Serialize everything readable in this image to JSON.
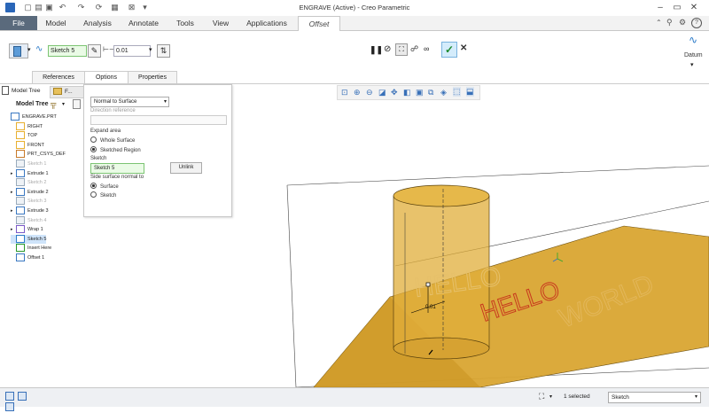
{
  "window": {
    "title": "ENGRAVE (Active) - Creo Parametric"
  },
  "menu": {
    "file": "File",
    "model": "Model",
    "analysis": "Analysis",
    "annotate": "Annotate",
    "tools": "Tools",
    "view": "View",
    "applications": "Applications",
    "offset": "Offset"
  },
  "ribbon": {
    "sketch_field": "Sketch 5",
    "offset_value": "0.01",
    "datum_label": "Datum"
  },
  "subtabs": {
    "references": "References",
    "options": "Options",
    "properties": "Properties"
  },
  "left_tabs": {
    "model_tree": "Model Tree",
    "folder": "F..."
  },
  "tree": {
    "header": "Model Tree",
    "items": [
      {
        "label": "ENGRAVE.PRT",
        "dim": false
      },
      {
        "label": "RIGHT",
        "dim": false
      },
      {
        "label": "TOP",
        "dim": false
      },
      {
        "label": "FRONT",
        "dim": false
      },
      {
        "label": "PRT_CSYS_DEF",
        "dim": false
      },
      {
        "label": "Sketch 1",
        "dim": true
      },
      {
        "label": "Extrude 1",
        "dim": false
      },
      {
        "label": "Sketch 2",
        "dim": true
      },
      {
        "label": "Extrude 2",
        "dim": false
      },
      {
        "label": "Sketch 3",
        "dim": true
      },
      {
        "label": "Extrude 3",
        "dim": false
      },
      {
        "label": "Sketch 4",
        "dim": true
      },
      {
        "label": "Wrap 1",
        "dim": false
      },
      {
        "label": "Sketch 5",
        "dim": false
      },
      {
        "label": "Insert Here",
        "dim": false
      },
      {
        "label": "Offset 1",
        "dim": false
      }
    ]
  },
  "options": {
    "dropdown": "Normal to Surface",
    "direction_reference": "Direction reference",
    "expand_area": "Expand area",
    "whole_surface": "Whole Surface",
    "sketched_region": "Sketched Region",
    "sketch_label": "Sketch",
    "sketch_value": "Sketch 5",
    "unlink": "Unlink",
    "side_normal": "Side surface normal to",
    "surface": "Surface",
    "sketch_opt": "Sketch"
  },
  "viewport": {
    "dim_text": "0.01",
    "hello1": "HELLO",
    "hello2": "HELLO",
    "world": "WORLD"
  },
  "status": {
    "selected": "1 selected",
    "filter": "Sketch"
  },
  "colors": {
    "accent": "#2f7fd6",
    "part": "#d9a531",
    "file_tab": "#5a6a7c"
  }
}
